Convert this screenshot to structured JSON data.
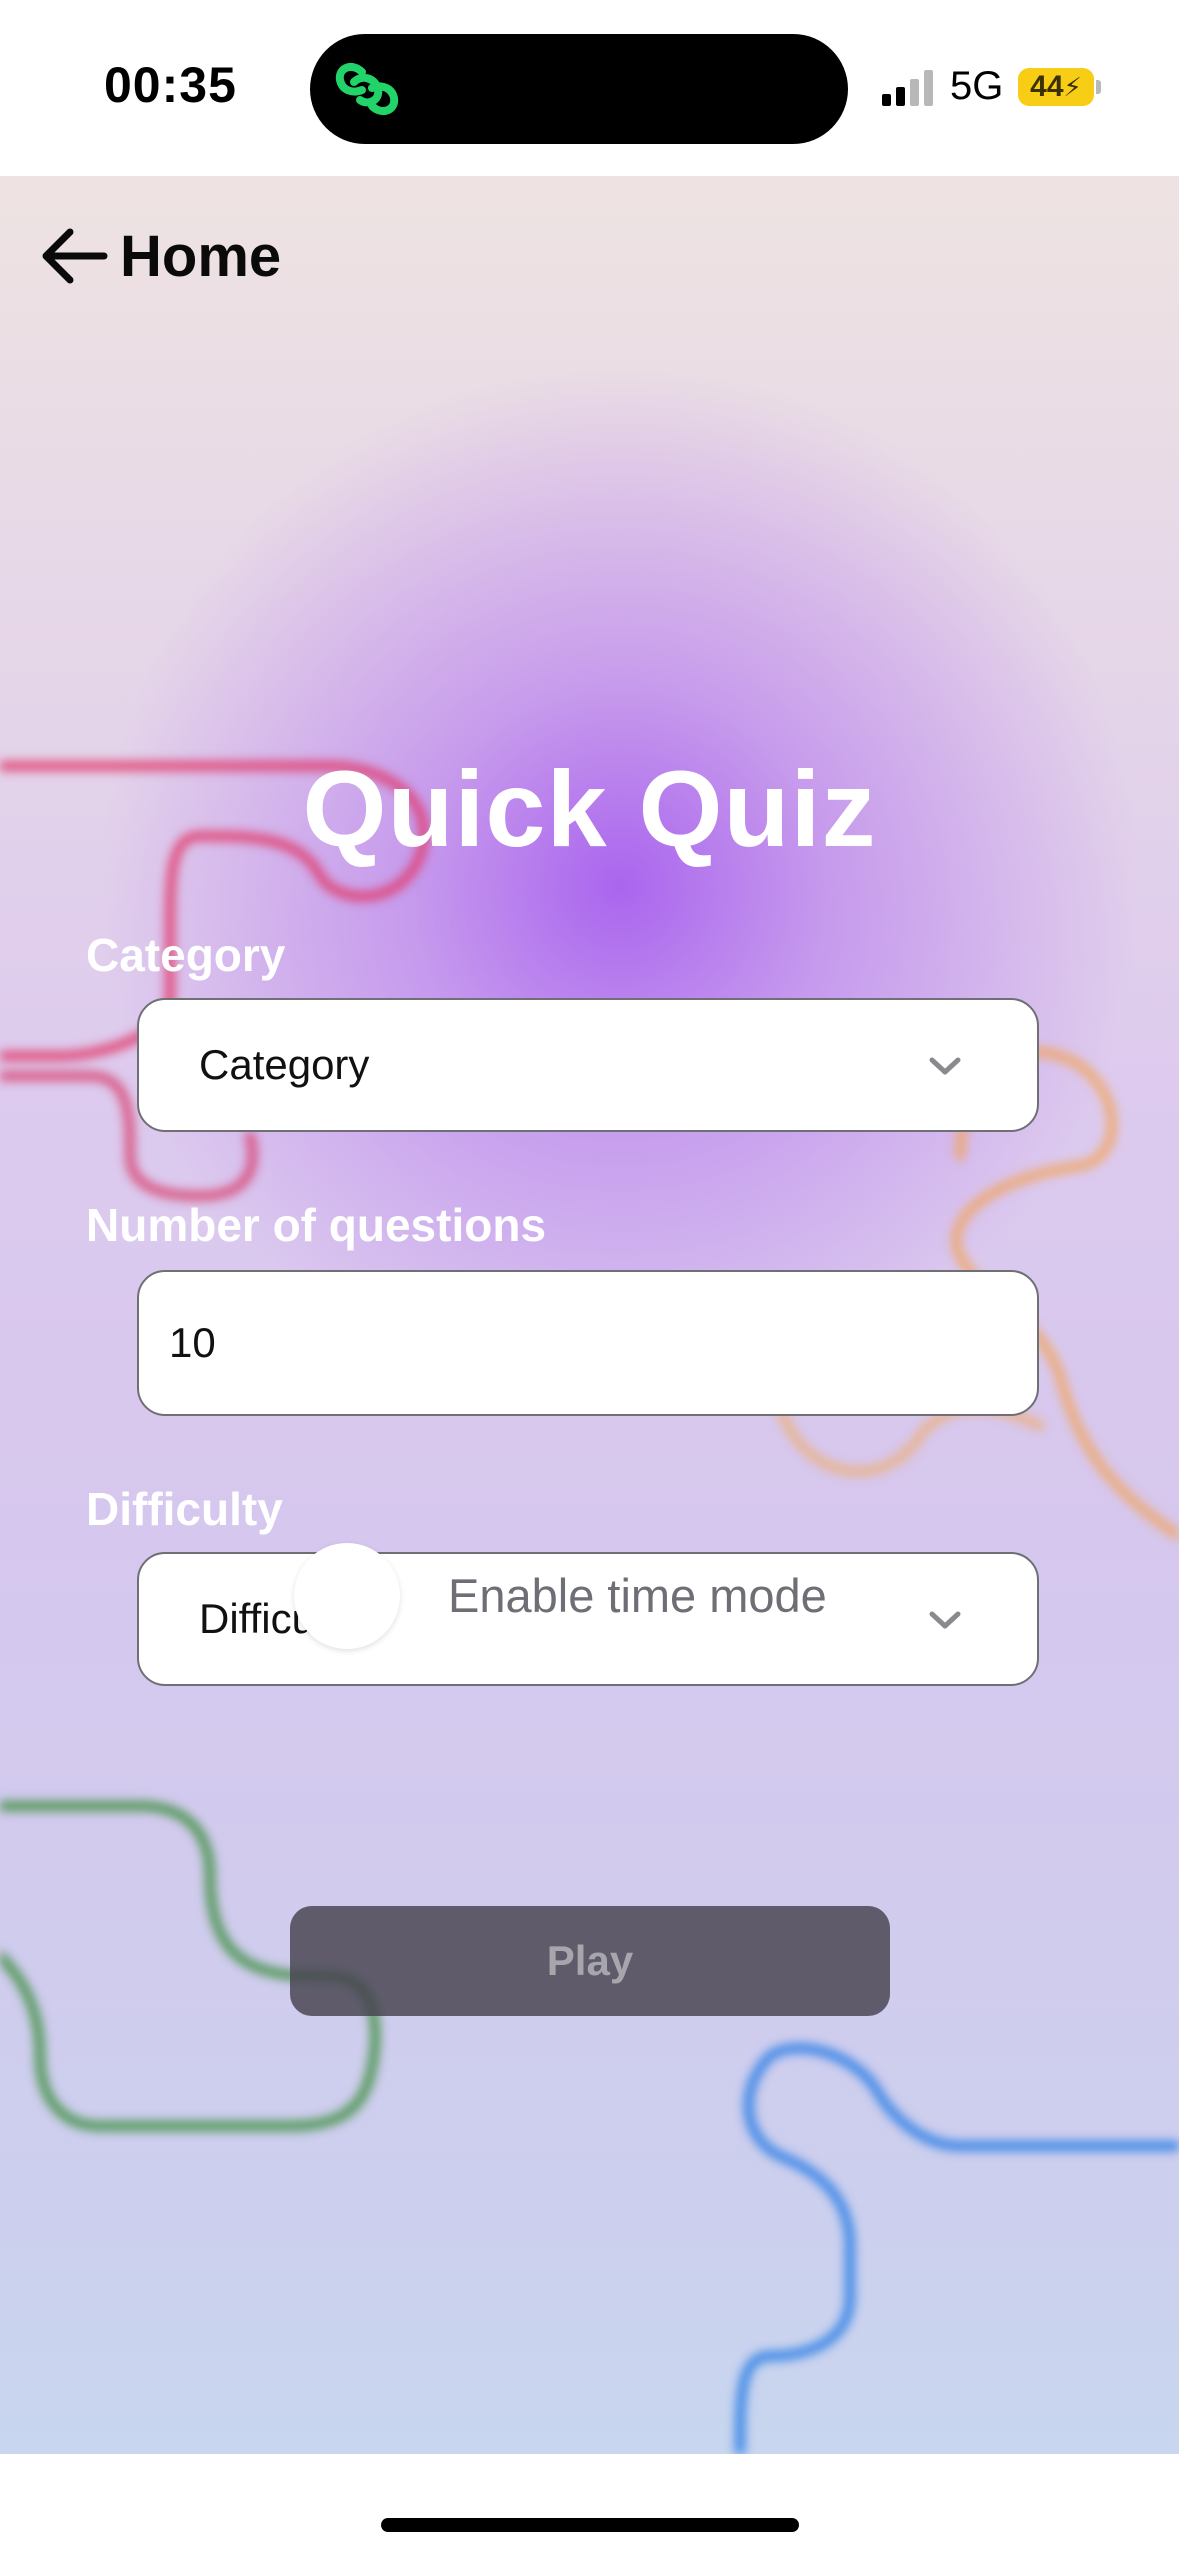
{
  "status_bar": {
    "time": "00:35",
    "network": "5G",
    "battery": "44",
    "island_icon": "link-chain-icon",
    "signal_icon": "cellular-signal-icon"
  },
  "nav": {
    "back_label": "Home",
    "back_icon": "arrow-left-icon"
  },
  "page": {
    "title": "Quick Quiz"
  },
  "form": {
    "category": {
      "label": "Category",
      "selected": "Category"
    },
    "num_questions": {
      "label": "Number of questions",
      "value": "10"
    },
    "difficulty": {
      "label": "Difficulty",
      "selected": "Difficulty"
    },
    "time_mode": {
      "label": "Enable time mode",
      "enabled": false
    },
    "play_label": "Play"
  },
  "colors": {
    "accent_glow": "#a65cee",
    "squiggle_red": "#e0305a",
    "squiggle_orange": "#f0a050",
    "squiggle_green": "#3a8a3a",
    "squiggle_blue": "#2f7fe0",
    "play_button": "#46424e"
  }
}
